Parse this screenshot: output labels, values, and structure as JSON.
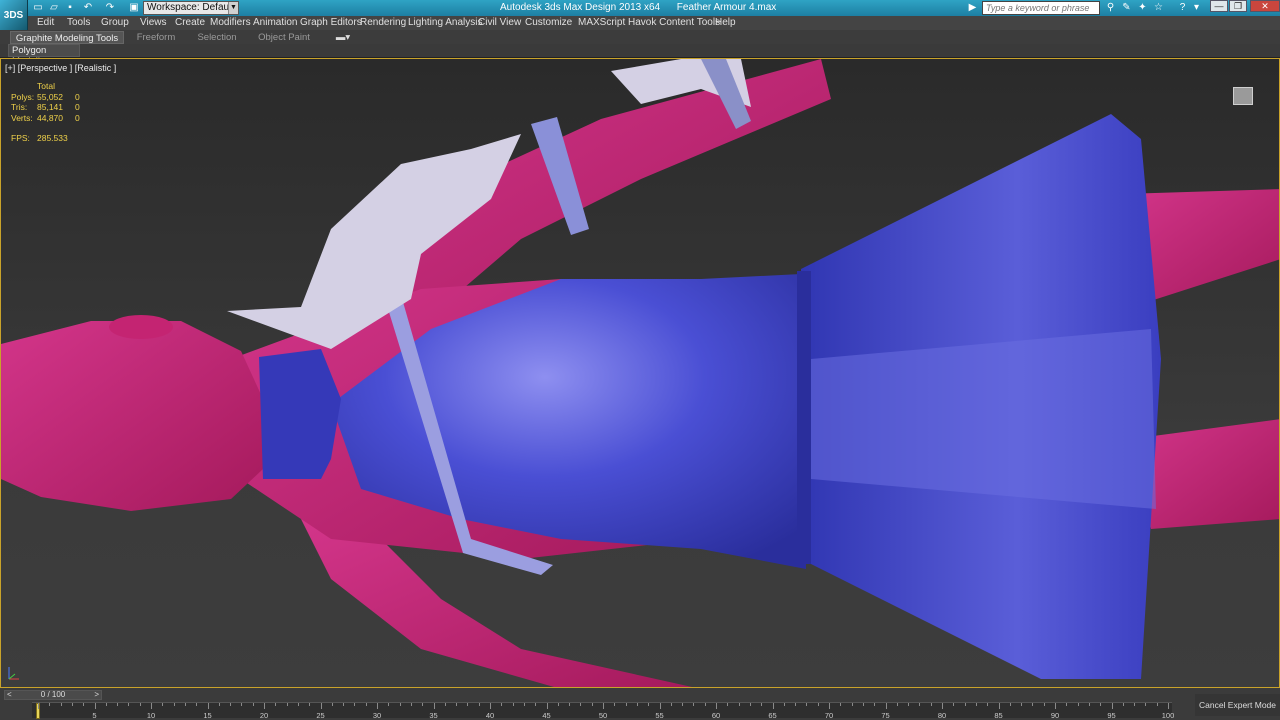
{
  "titlebar": {
    "app_logo": "3DS",
    "workspace": "Workspace: Default",
    "window_title": "Autodesk 3ds Max Design 2013 x64      Feather Armour 4.max",
    "search_placeholder": "Type a keyword or phrase"
  },
  "menubar": {
    "items": [
      "Edit",
      "Tools",
      "Group",
      "Views",
      "Create",
      "Modifiers",
      "Animation",
      "Graph Editors",
      "Rendering",
      "Lighting Analysis",
      "Civil View",
      "Customize",
      "MAXScript",
      "Havok Content Tools",
      "Help"
    ]
  },
  "ribbon": {
    "tabs": [
      "Graphite Modeling Tools",
      "Freeform",
      "Selection",
      "Object Paint"
    ],
    "panel_button": "Polygon Modeling"
  },
  "viewport": {
    "label": "[+] [Perspective ] [Realistic ]",
    "stats": {
      "header": "Total",
      "rows": [
        {
          "key": "Polys:",
          "total": "55,052",
          "sel": "0"
        },
        {
          "key": "Tris:",
          "total": "85,141",
          "sel": "0"
        },
        {
          "key": "Verts:",
          "total": "44,870",
          "sel": "0"
        }
      ],
      "fps_label": "FPS:",
      "fps_value": "285.533"
    },
    "colors": {
      "skin": "#c2206e",
      "dress": "#3a3fc4",
      "armor": "#c8c4dc",
      "strap": "#8a90d8",
      "border": "#c9a32a"
    }
  },
  "timeline": {
    "slider": "0 / 100",
    "ticks": [
      "5",
      "10",
      "15",
      "20",
      "25",
      "30",
      "35",
      "40",
      "45",
      "50",
      "55",
      "60",
      "65",
      "70",
      "75",
      "80",
      "85",
      "90",
      "95",
      "100"
    ],
    "cancel_expert": "Cancel Expert Mode"
  }
}
